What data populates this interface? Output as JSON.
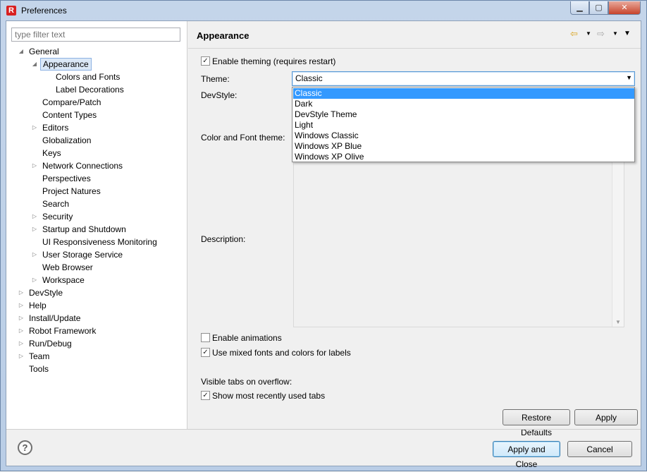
{
  "window": {
    "app_icon": "R",
    "title": "Preferences",
    "minimize_icon": "minimize-icon",
    "maximize_icon": "maximize-icon",
    "close_icon": "close-icon"
  },
  "left": {
    "filter_placeholder": "type filter text",
    "tree": [
      {
        "label": "General",
        "expanded": true
      },
      {
        "label": "Appearance",
        "expanded": true,
        "selected": true
      },
      {
        "label": "Colors and Fonts"
      },
      {
        "label": "Label Decorations"
      },
      {
        "label": "Compare/Patch"
      },
      {
        "label": "Content Types"
      },
      {
        "label": "Editors",
        "collapsed": true
      },
      {
        "label": "Globalization"
      },
      {
        "label": "Keys"
      },
      {
        "label": "Network Connections",
        "collapsed": true
      },
      {
        "label": "Perspectives"
      },
      {
        "label": "Project Natures"
      },
      {
        "label": "Search"
      },
      {
        "label": "Security",
        "collapsed": true
      },
      {
        "label": "Startup and Shutdown",
        "collapsed": true
      },
      {
        "label": "UI Responsiveness Monitoring"
      },
      {
        "label": "User Storage Service",
        "collapsed": true
      },
      {
        "label": "Web Browser"
      },
      {
        "label": "Workspace",
        "collapsed": true
      },
      {
        "label": "DevStyle",
        "collapsed": true
      },
      {
        "label": "Help",
        "collapsed": true
      },
      {
        "label": "Install/Update",
        "collapsed": true
      },
      {
        "label": "Robot Framework",
        "collapsed": true
      },
      {
        "label": "Run/Debug",
        "collapsed": true
      },
      {
        "label": "Team",
        "collapsed": true
      },
      {
        "label": "Tools"
      }
    ]
  },
  "page": {
    "title": "Appearance",
    "nav": {
      "back_icon": "back-arrow-icon",
      "forward_icon": "forward-arrow-icon",
      "menu_icon": "view-menu-icon"
    },
    "enable_theming": {
      "label": "Enable theming (requires restart)",
      "checked": true
    },
    "theme": {
      "label": "Theme:",
      "value": "Classic",
      "options": [
        "Classic",
        "Dark",
        "DevStyle Theme",
        "Light",
        "Windows Classic",
        "Windows XP Blue",
        "Windows XP Olive"
      ],
      "highlighted": "Classic"
    },
    "devstyle_label": "DevStyle:",
    "color_font_theme_label": "Color and Font theme:",
    "description_label": "Description:",
    "enable_animations": {
      "label": "Enable animations",
      "checked": false
    },
    "mixed_fonts": {
      "label": "Use mixed fonts and colors for labels",
      "checked": true
    },
    "visible_tabs_label": "Visible tabs on overflow:",
    "show_mru": {
      "label": "Show most recently used tabs",
      "checked": true
    },
    "restore_defaults": "Restore Defaults",
    "apply": "Apply"
  },
  "footer": {
    "help_icon": "help-icon",
    "apply_close": "Apply and Close",
    "cancel": "Cancel"
  }
}
